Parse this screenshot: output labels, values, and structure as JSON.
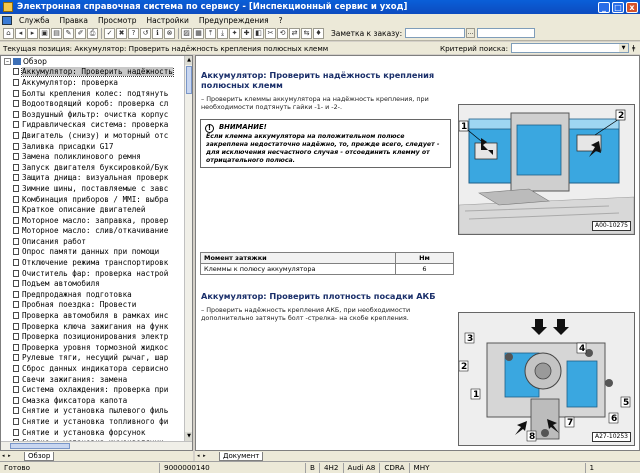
{
  "window": {
    "title": "Электронная справочная система по сервису - [Инспекционный сервис и уход]",
    "min": "_",
    "max": "□",
    "close": "x"
  },
  "menu": [
    "Служба",
    "Правка",
    "Просмотр",
    "Настройки",
    "Предупреждения",
    "?"
  ],
  "toolbar": {
    "buttons": [
      "⌂",
      "◂",
      "▸",
      "▣",
      "▤",
      "✎",
      "✐",
      "⎙",
      "✓",
      "✖",
      "?",
      "↺",
      "ℹ",
      "⊗",
      "▨",
      "▦",
      "⤒",
      "⤓",
      "✦",
      "✚",
      "◧",
      "✂",
      "⟲",
      "⇄",
      "⇆",
      "♦"
    ],
    "order_label": "Заметка к заказу:",
    "order_btn": "…"
  },
  "position": {
    "text": "Текущая позиция: Аккумулятор: Проверить надёжность крепления полюсных клемм",
    "criteria_label": "Критерий поиска:",
    "pin": "ǂ"
  },
  "tree": {
    "root": "Обзор",
    "root_toggle": "–",
    "items": [
      "Аккумулятор: Проверить надёжность",
      "Аккумулятор: проверка",
      "Болты крепления колес: подтянуть",
      "Водоотводящий короб: проверка сл",
      "Воздушный фильтр: очистка корпус",
      "Гидравлическая система: проверка",
      "Двигатель (снизу) и моторный отс",
      "Заливка присадки G17",
      "Замена поликлинового ремня",
      "Запуск двигателя буксировкой/Бук",
      "Защита днища: визуальная проверк",
      "Зимние шины, поставляемые с завс",
      "Комбинация приборов / MMI: выбра",
      "Краткое описание двигателей",
      "Моторное масло: заправка, провер",
      "Моторное масло: слив/откачивание",
      "Описания работ",
      "Опрос памяти данных при помощи",
      "Отключение режима транспортировк",
      "Очиститель фар: проверка настрой",
      "Подъем автомобиля",
      "Предпродажная подготовка",
      "Пробная поездка: Провести",
      "Проверка автомобиля в рамках инс",
      "Проверка ключа зажигания на функ",
      "Проверка позиционирования электр",
      "Проверка уровня тормозной жидкос",
      "Рулевые тяги, несущий рычаг, шар",
      "Сброс данных индикатора сервисно",
      "Свечи зажигания: замена",
      "Система охлаждения: проверка при",
      "Смазка фиксатора капота",
      "Снятие и установка пылевого филь",
      "Снятие и установка топливного фи",
      "Снятие и установка форсунок",
      "Снятие и установка шумоизоляции"
    ],
    "tab": "Обзор",
    "tab_indicator": "◂ ▸"
  },
  "doc": {
    "section1_title": "Аккумулятор: Проверить надёжность крепления полюсных клемм",
    "section1_step": "–  Проверить клеммы аккумулятора на надёжность крепления, при необходимости подтянуть гайки -1- и -2-.",
    "warning_icon": "!",
    "warning_title": "ВНИМАНИЕ!",
    "warning_text": "Если клемма аккумулятора на положительном полюсе закреплена недостаточно надёжно, то, прежде всего, следует - для исключения несчастного случая - отсоединить клемму от отрицательного полюса.",
    "figure1_id": "A00-10275",
    "figure1_callouts": [
      "1",
      "2"
    ],
    "torque_header": [
      "Момент затяжки",
      "Нм"
    ],
    "torque_rows": [
      [
        "Клеммы к полюсу аккумулятора",
        "6"
      ]
    ],
    "section2_title": "Аккумулятор: Проверить плотность посадки АКБ",
    "section2_step": "–  Проверить надёжность крепления АКБ, при необходимости дополнительно затянуть болт -стрелка- на скобе крепления.",
    "figure2_id": "A27-10253",
    "figure2_callouts": [
      "3",
      "4",
      "2",
      "1",
      "5",
      "6",
      "7",
      "8"
    ],
    "tab": "Документ"
  },
  "status": {
    "ready": "Готово",
    "order": "9000000140",
    "cells": [
      "B",
      "4H2",
      "Audi A8",
      "CDRA",
      "MHY"
    ],
    "page": "1"
  }
}
